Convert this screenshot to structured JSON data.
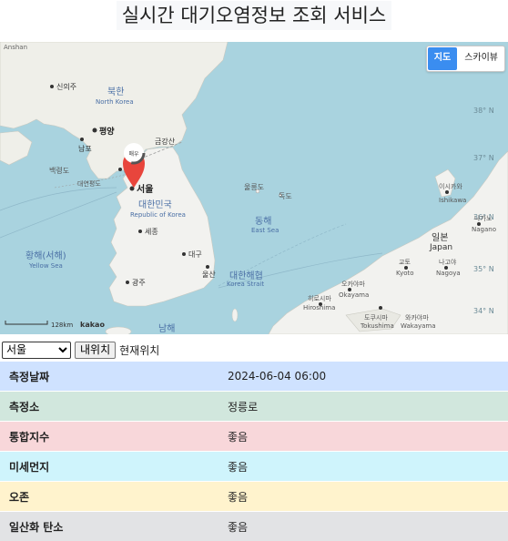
{
  "title": "실시간 대기오염정보 조회 서비스",
  "map": {
    "type_buttons": [
      "지도",
      "스카이뷰"
    ],
    "marker_text": "매우",
    "scale_text": "128km",
    "copyright": "kakao",
    "labels": {
      "anshan": "Anshan",
      "north_korea": "북한",
      "north_korea_en": "North Korea",
      "sinuiju": "신의주",
      "pyongyang": "평양",
      "nampo": "남포",
      "geumgangsan": "금강산",
      "baengnyeong": "백령도",
      "daeyeonpyeong": "대연평도",
      "gae": "개",
      "seoul": "서울",
      "south_korea": "대한민국",
      "south_korea_en": "Republic of Korea",
      "sejong": "세종",
      "daegu": "대구",
      "ulsan": "울산",
      "gwangju": "광주",
      "ulleungdo": "울릉도",
      "dokdo": "독도",
      "east_sea": "동해",
      "east_sea_en": "East Sea",
      "yellow_sea": "황해(서해)",
      "yellow_sea_en": "Yellow Sea",
      "korea_strait": "대한해협",
      "korea_strait_en": "Korea Strait",
      "south_sea": "남해",
      "japan": "일본",
      "japan_en": "Japan",
      "ishikawa": "이시카와",
      "ishikawa_en": "Ishikawa",
      "nagano": "나가노",
      "nagano_en": "Nagano",
      "kyoto": "교토",
      "kyoto_en": "Kyoto",
      "nagoya": "나고야",
      "nagoya_en": "Nagoya",
      "okayama": "오카야마",
      "okayama_en": "Okayama",
      "hiroshima": "히로시마",
      "hiroshima_en": "Hiroshima",
      "tokushima": "도쿠시마",
      "tokushima_en": "Tokushima",
      "wakayama": "와카야마",
      "wakayama_en": "Wakayama",
      "lat_38": "38° N",
      "lat_37": "37° N",
      "lat_36": "36° N",
      "lat_35": "35° N",
      "lat_34": "34° N"
    }
  },
  "controls": {
    "selected_city": "서울",
    "my_location_button": "내위치",
    "current_location_label": "현재위치"
  },
  "info_rows": [
    {
      "label": "측정날짜",
      "value": "2024-06-04 06:00"
    },
    {
      "label": "측정소",
      "value": "정릉로"
    },
    {
      "label": "통합지수",
      "value": "좋음"
    },
    {
      "label": "미세먼지",
      "value": "좋음"
    },
    {
      "label": "오존",
      "value": "좋음"
    },
    {
      "label": "일산화 탄소",
      "value": "좋음"
    }
  ],
  "colors": {
    "marker": "#e8453c",
    "water": "#a9d3df",
    "land": "#f2f2ef",
    "active_button": "#3a8df0"
  }
}
